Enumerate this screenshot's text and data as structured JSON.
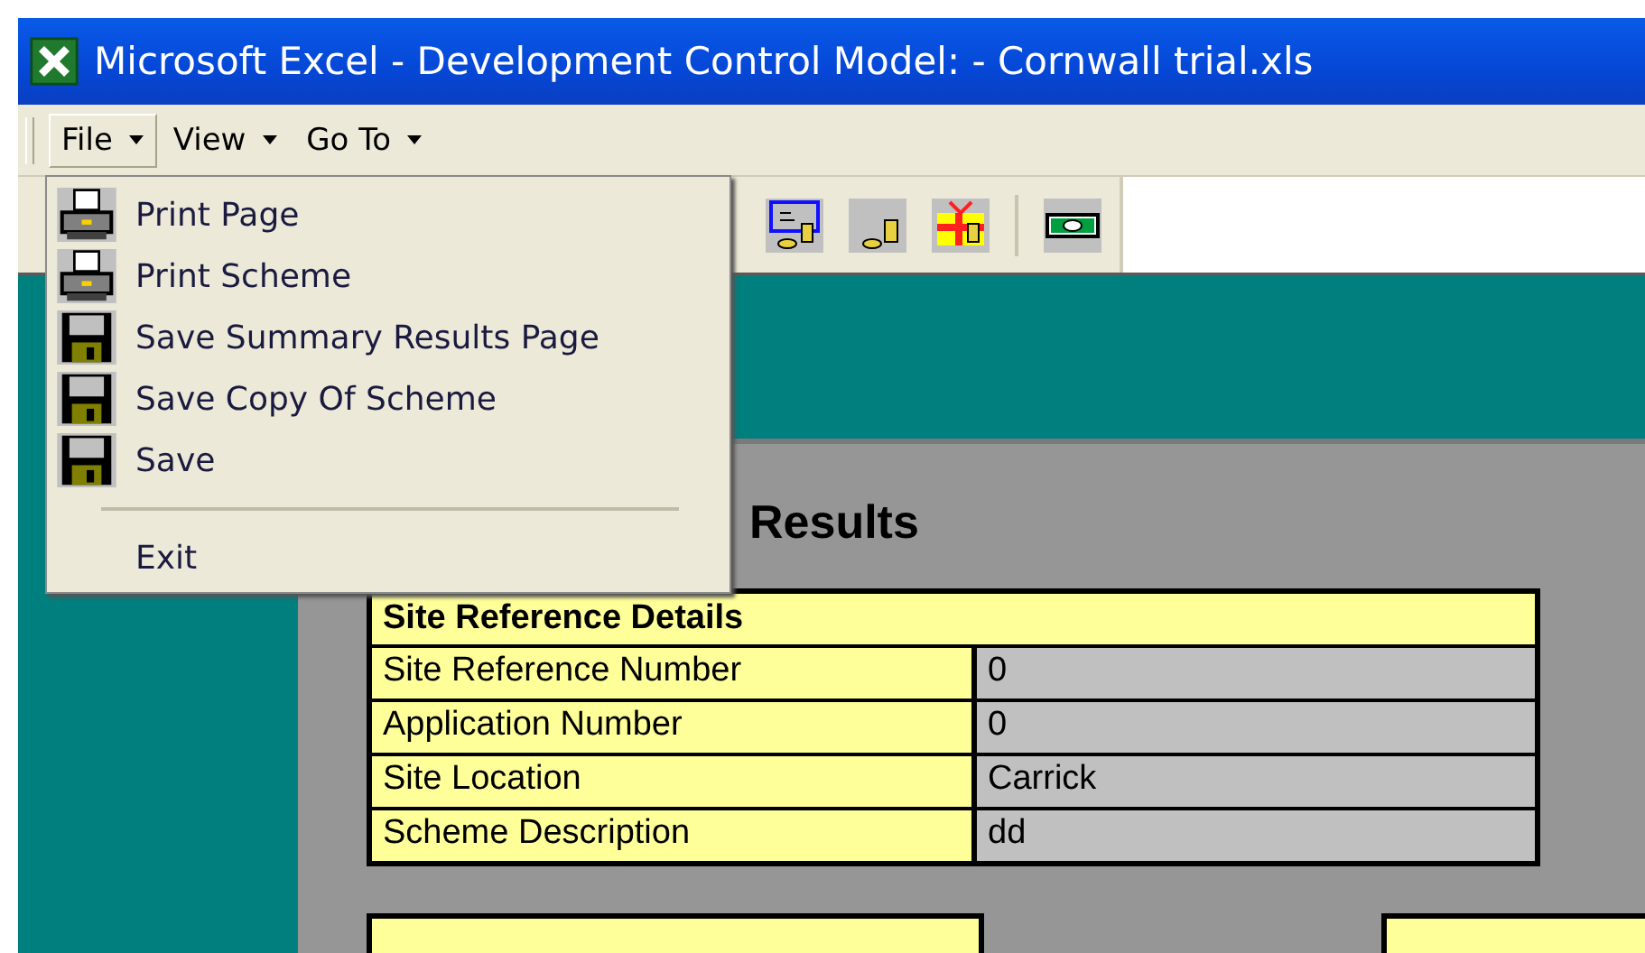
{
  "window": {
    "title": "Microsoft Excel - Development Control Model: - Cornwall trial.xls"
  },
  "menu_bar": [
    {
      "label": "File",
      "selected": true
    },
    {
      "label": "View",
      "selected": false
    },
    {
      "label": "Go To",
      "selected": false
    }
  ],
  "toolbar": [
    {
      "kind": "scroll"
    },
    {
      "kind": "coins"
    },
    {
      "kind": "gift"
    },
    {
      "kind": "separator"
    },
    {
      "kind": "banknote"
    }
  ],
  "file_menu": [
    {
      "kind": "printer",
      "label": "Print Page"
    },
    {
      "kind": "printer",
      "label": "Print Scheme"
    },
    {
      "kind": "floppy",
      "label": "Save Summary Results Page"
    },
    {
      "kind": "floppy",
      "label": "Save Copy Of Scheme"
    },
    {
      "kind": "floppy",
      "label": "Save"
    },
    {
      "kind": "separator"
    },
    {
      "kind": "plain",
      "label": "Exit"
    }
  ],
  "sheet": {
    "heading": "Results",
    "site_details": {
      "title": "Site Reference Details",
      "rows": [
        {
          "label": "Site Reference Number",
          "value": "0"
        },
        {
          "label": "Application Number",
          "value": "0"
        },
        {
          "label": "Site Location",
          "value": "Carrick"
        },
        {
          "label": "Scheme Description",
          "value": "dd"
        }
      ]
    }
  }
}
